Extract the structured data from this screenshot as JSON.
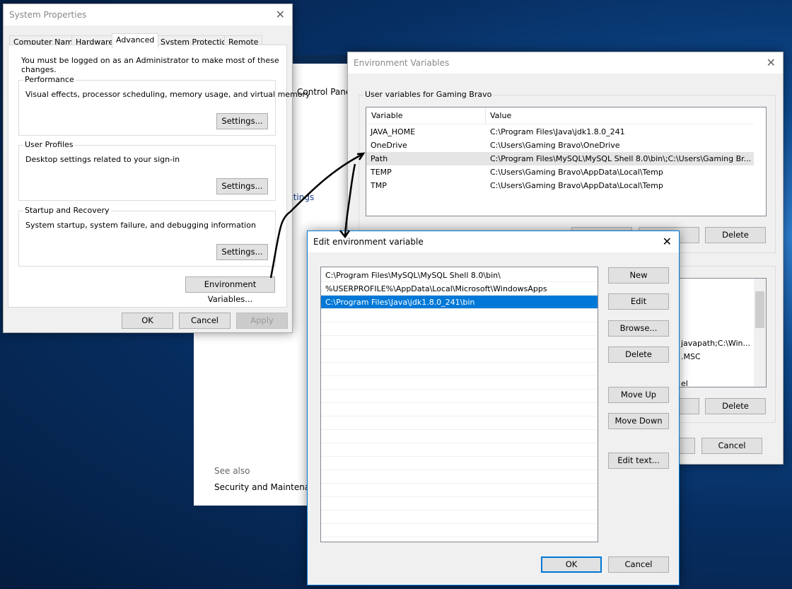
{
  "control_panel": {
    "breadcrumb": "Control Panel",
    "link_partial": "ttings",
    "see_also": "See also",
    "security_link": "Security and Maintenance"
  },
  "system_properties": {
    "title": "System Properties",
    "tabs": [
      "Computer Name",
      "Hardware",
      "Advanced",
      "System Protection",
      "Remote"
    ],
    "active_tab": "Advanced",
    "admin_note": "You must be logged on as an Administrator to make most of these changes.",
    "groups": [
      {
        "label": "Performance",
        "desc": "Visual effects, processor scheduling, memory usage, and virtual memory",
        "button": "Settings..."
      },
      {
        "label": "User Profiles",
        "desc": "Desktop settings related to your sign-in",
        "button": "Settings..."
      },
      {
        "label": "Startup and Recovery",
        "desc": "System startup, system failure, and debugging information",
        "button": "Settings..."
      }
    ],
    "env_button": "Environment Variables...",
    "ok": "OK",
    "cancel": "Cancel",
    "apply": "Apply"
  },
  "env_vars": {
    "title": "Environment Variables",
    "user_group": "User variables for Gaming Bravo",
    "columns": [
      "Variable",
      "Value"
    ],
    "rows": [
      [
        "JAVA_HOME",
        "C:\\Program Files\\Java\\jdk1.8.0_241"
      ],
      [
        "OneDrive",
        "C:\\Users\\Gaming Bravo\\OneDrive"
      ],
      [
        "Path",
        "C:\\Program Files\\MySQL\\MySQL Shell 8.0\\bin\\;C:\\Users\\Gaming Br..."
      ],
      [
        "TEMP",
        "C:\\Users\\Gaming Bravo\\AppData\\Local\\Temp"
      ],
      [
        "TMP",
        "C:\\Users\\Gaming Bravo\\AppData\\Local\\Temp"
      ]
    ],
    "user_delete": "Delete",
    "system_partial": [
      "javapath;C:\\Win...",
      ".MSC",
      "el"
    ],
    "system_delete": "Delete",
    "cancel": "Cancel"
  },
  "edit_var": {
    "title": "Edit environment variable",
    "entries": [
      "C:\\Program Files\\MySQL\\MySQL Shell 8.0\\bin\\",
      "%USERPROFILE%\\AppData\\Local\\Microsoft\\WindowsApps",
      "C:\\Program Files\\Java\\jdk1.8.0_241\\bin"
    ],
    "selected_index": 2,
    "buttons": {
      "new": "New",
      "edit": "Edit",
      "browse": "Browse...",
      "delete": "Delete",
      "move_up": "Move Up",
      "move_down": "Move Down",
      "edit_text": "Edit text..."
    },
    "ok": "OK",
    "cancel": "Cancel"
  },
  "colors": {
    "accent": "#0078d7",
    "selection": "#0078d7"
  }
}
